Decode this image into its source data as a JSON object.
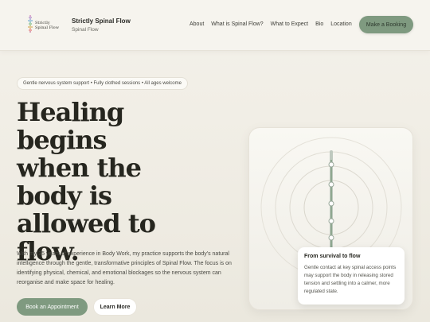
{
  "header": {
    "brand_logo_text": "Strictly Spinal Flow",
    "brand_name": "Strictly Spinal Flow",
    "brand_sub": "Spinal Flow",
    "nav": [
      "About",
      "What is Spinal Flow?",
      "What to Expect",
      "Bio",
      "Location"
    ],
    "booking_label": "Make a Booking"
  },
  "hero": {
    "pill_text": "Gentle nervous system support • Fully clothed sessions • All ages welcome",
    "headline": "Healing begins when the body is allowed to flow.",
    "intro": "With my 35 years of experience in Body Work, my practice supports the body's natural intelligence through the gentle, transformative principles of Spinal Flow. The focus is on identifying physical, chemical, and emotional blockages so the nervous system can reorganise and make space for healing.",
    "primary_cta": "Book an Appointment",
    "secondary_cta": "Learn More"
  },
  "visual_card": {
    "title": "From survival to flow",
    "text": "Gentle contact at key spinal access points may support the body in releasing stored tension and settling into a calmer, more regulated state."
  },
  "colors": {
    "accent_green": "#7f9a80",
    "background": "#f2efe7",
    "text_dark": "#26261f"
  }
}
